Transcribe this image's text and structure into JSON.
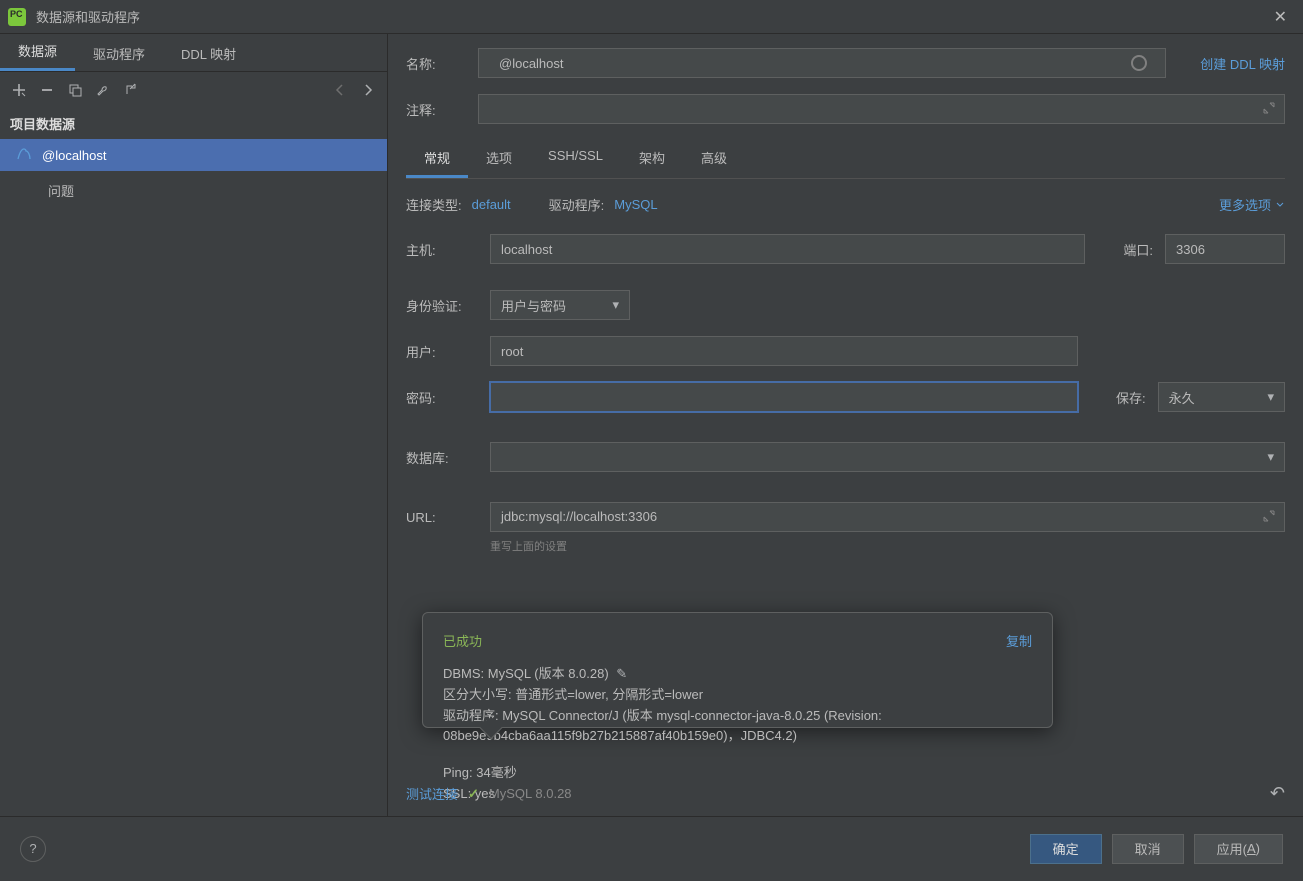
{
  "titlebar": {
    "title": "数据源和驱动程序"
  },
  "topTabs": {
    "t0": "数据源",
    "t1": "驱动程序",
    "t2": "DDL 映射"
  },
  "sections": {
    "project": "项目数据源",
    "problems": "问题"
  },
  "datasource": {
    "name": "@localhost"
  },
  "labels": {
    "name": "名称:",
    "comment": "注释:",
    "connType": "连接类型:",
    "driver": "驱动程序:",
    "more": "更多选项",
    "host": "主机:",
    "port": "端口:",
    "auth": "身份验证:",
    "user": "用户:",
    "password": "密码:",
    "save": "保存:",
    "database": "数据库:",
    "url": "URL:",
    "urlHint": "重写上面的设置"
  },
  "links": {
    "createDdl": "创建 DDL 映射"
  },
  "subTabs": {
    "s0": "常规",
    "s1": "选项",
    "s2": "SSH/SSL",
    "s3": "架构",
    "s4": "高级"
  },
  "values": {
    "connType": "default",
    "driver": "MySQL",
    "host": "localhost",
    "port": "3306",
    "auth": "用户与密码",
    "user": "root",
    "password": "",
    "save": "永久",
    "database": "",
    "url": "jdbc:mysql://localhost:3306"
  },
  "popup": {
    "success": "已成功",
    "copy": "复制",
    "l1a": "DBMS: MySQL (版本 8.0.28)",
    "l2": "区分大小写: 普通形式=lower, 分隔形式=lower",
    "l3": "驱动程序: MySQL Connector/J (版本 mysql-connector-java-8.0.25 (Revision: 08be9e9b4cba6aa115f9b27b215887af40b159e0)，JDBC4.2)",
    "l4": "Ping: 34毫秒",
    "l5": "SSL: yes"
  },
  "test": {
    "link": "测试连接",
    "version": "MySQL 8.0.28"
  },
  "footer": {
    "ok": "确定",
    "cancel": "取消",
    "applyPrefix": "应用(",
    "applyKey": "A",
    "applySuffix": ")"
  }
}
